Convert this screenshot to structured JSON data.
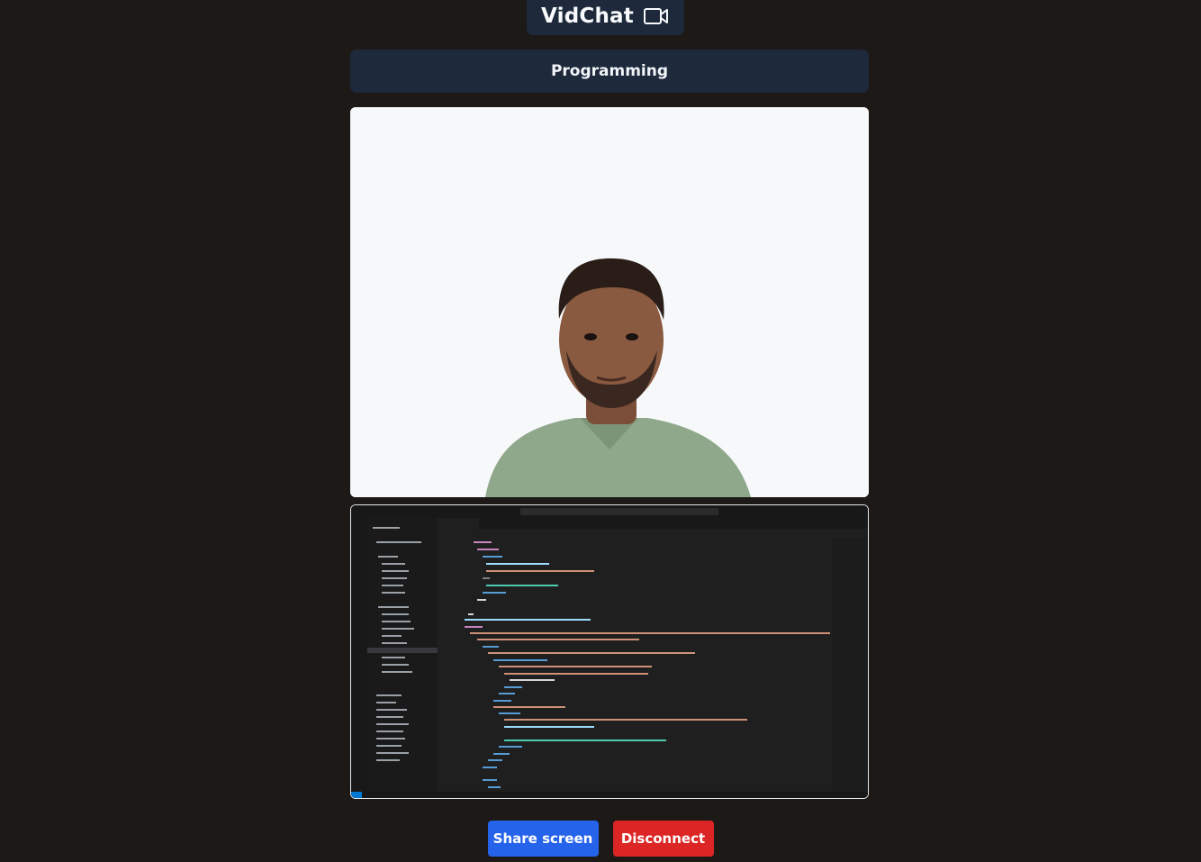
{
  "brand": {
    "title": "VidChat",
    "icon": "video-camera-icon"
  },
  "room": {
    "name": "Programming"
  },
  "streams": {
    "camera": {
      "label": "camera-stream"
    },
    "screen": {
      "editor_tab": "Navbar",
      "editor_search": "portfolio",
      "explorer_title": "EXPLORER"
    }
  },
  "controls": {
    "share_label": "Share screen",
    "disconnect_label": "Disconnect"
  },
  "colors": {
    "background": "#1c1917",
    "panel": "#1e293b",
    "share": "#2563eb",
    "disconnect": "#dc2626"
  }
}
